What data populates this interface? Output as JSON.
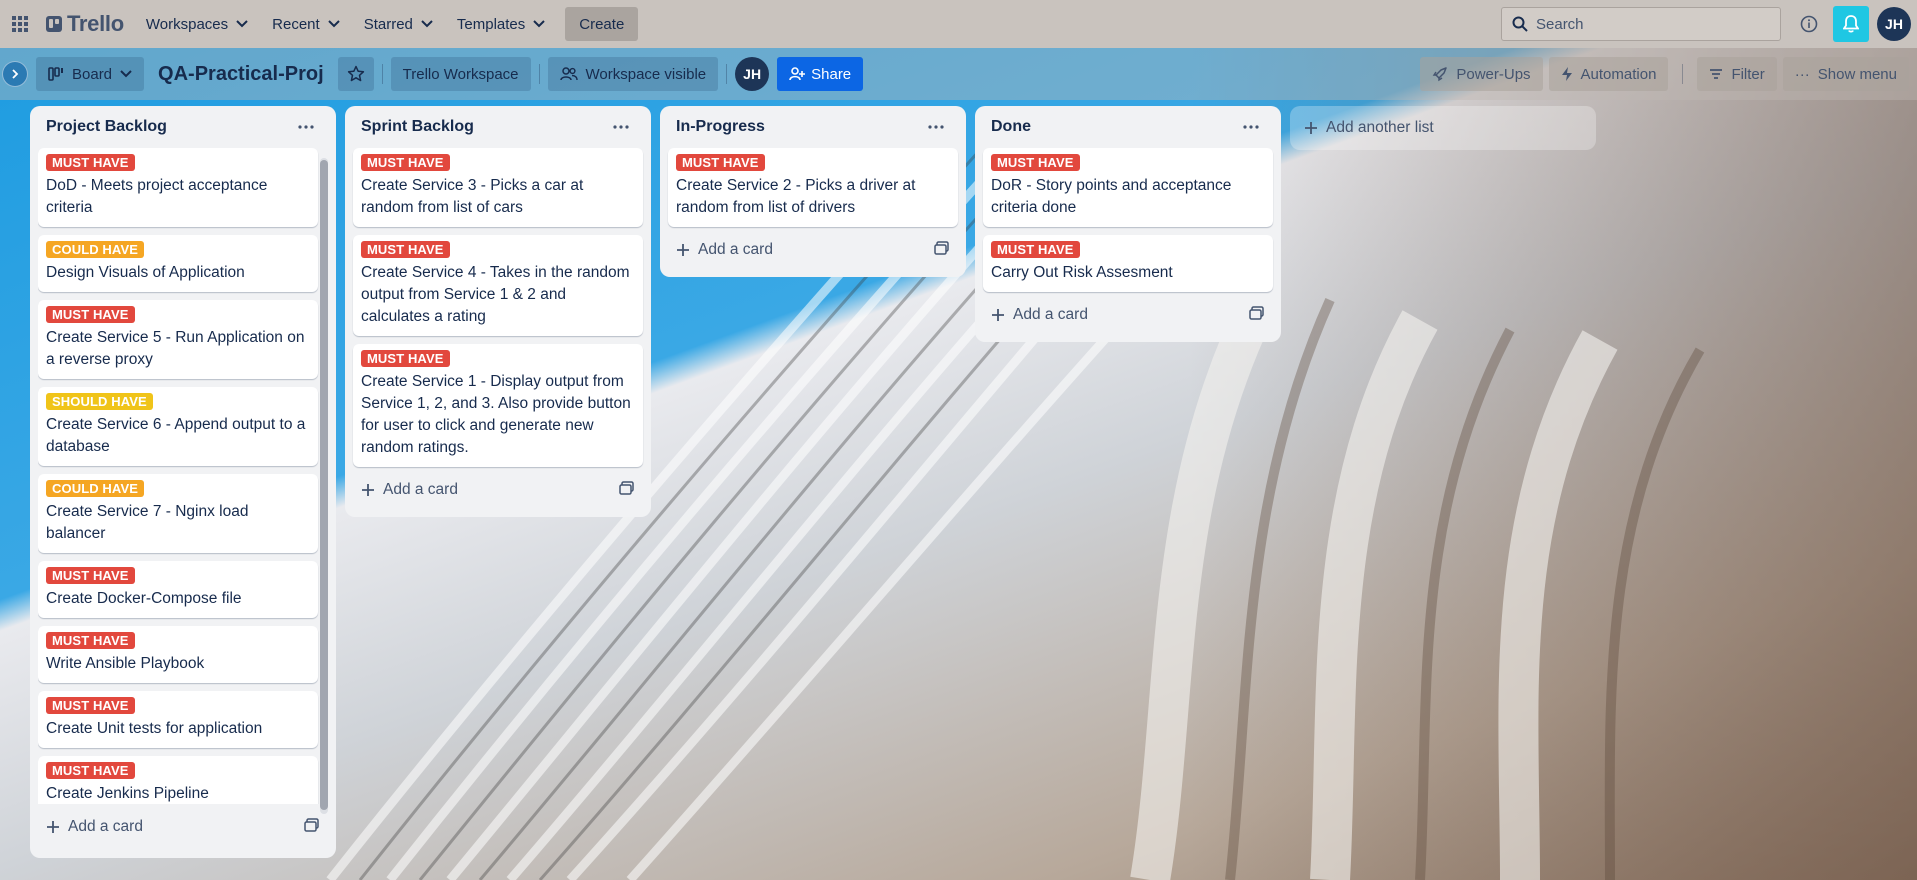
{
  "nav": {
    "brand": "Trello",
    "workspaces": "Workspaces",
    "recent": "Recent",
    "starred": "Starred",
    "templates": "Templates",
    "create": "Create",
    "search_placeholder": "Search",
    "avatar_initials": "JH"
  },
  "board_header": {
    "view": "Board",
    "title": "QA-Practical-Proj",
    "workspace": "Trello Workspace",
    "visibility": "Workspace visible",
    "member_initials": "JH",
    "share": "Share",
    "powerups": "Power-Ups",
    "automation": "Automation",
    "filter": "Filter",
    "show_menu": "Show menu"
  },
  "lists": [
    {
      "title": "Project Backlog",
      "cards": [
        {
          "label": "MUST HAVE",
          "type": "must",
          "text": "DoD - Meets project acceptance criteria"
        },
        {
          "label": "COULD HAVE",
          "type": "could",
          "text": "Design Visuals of Application"
        },
        {
          "label": "MUST HAVE",
          "type": "must",
          "text": "Create Service 5 - Run Application on a reverse proxy"
        },
        {
          "label": "SHOULD HAVE",
          "type": "should",
          "text": "Create Service 6 - Append output to a database"
        },
        {
          "label": "COULD HAVE",
          "type": "could",
          "text": "Create Service 7 - Nginx load balancer"
        },
        {
          "label": "MUST HAVE",
          "type": "must",
          "text": "Create Docker-Compose file"
        },
        {
          "label": "MUST HAVE",
          "type": "must",
          "text": "Write Ansible Playbook"
        },
        {
          "label": "MUST HAVE",
          "type": "must",
          "text": "Create Unit tests for application"
        },
        {
          "label": "MUST HAVE",
          "type": "must",
          "text": "Create Jenkins Pipeline"
        }
      ],
      "add_card": "Add a card"
    },
    {
      "title": "Sprint Backlog",
      "cards": [
        {
          "label": "MUST HAVE",
          "type": "must",
          "text": "Create Service 3 - Picks a car at random from list of cars"
        },
        {
          "label": "MUST HAVE",
          "type": "must",
          "text": "Create Service 4 - Takes in the random output from Service 1 & 2 and calculates a rating"
        },
        {
          "label": "MUST HAVE",
          "type": "must",
          "text": "Create Service 1 - Display output from Service 1, 2, and 3. Also provide button for user to click and generate new random ratings."
        }
      ],
      "add_card": "Add a card"
    },
    {
      "title": "In-Progress",
      "cards": [
        {
          "label": "MUST HAVE",
          "type": "must",
          "text": "Create Service 2 - Picks a driver at random from list of drivers"
        }
      ],
      "add_card": "Add a card"
    },
    {
      "title": "Done",
      "cards": [
        {
          "label": "MUST HAVE",
          "type": "must",
          "text": "DoR - Story points and acceptance criteria done"
        },
        {
          "label": "MUST HAVE",
          "type": "must",
          "text": "Carry Out Risk Assesment"
        }
      ],
      "add_card": "Add a card"
    }
  ],
  "add_list": "Add another list",
  "colors": {
    "must": "#e2483d",
    "could": "#f5a623",
    "should": "#f0c419",
    "share": "#0c66e4",
    "notification": "#1fc7e3"
  }
}
